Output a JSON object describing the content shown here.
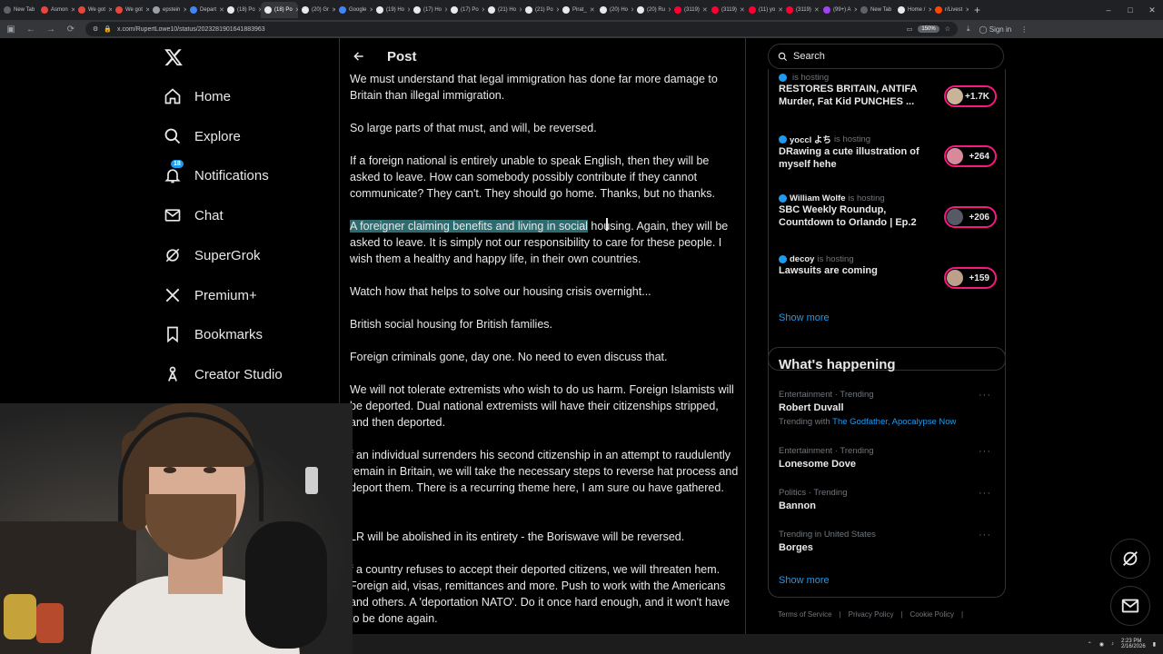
{
  "browser": {
    "tabs": [
      "New Tab",
      "Asmon",
      "We got",
      "We got",
      "epstein",
      "Depart",
      "(18) Po",
      "(18) Po",
      "(20) Gr",
      "Google",
      "(19) Ho",
      "(17) Ho",
      "(17) Po",
      "(21) Ho",
      "(21) Po",
      "Pirat_",
      "(20) Ho",
      "(20) Ru",
      "(3119)",
      "(3119)",
      "(11) yo",
      "(3119)",
      "(99+) A",
      "New Tab",
      "Home /",
      "r/Livest"
    ],
    "active_tab_index": 7,
    "url": "x.com/RupertLowe10/status/2023281901641883963",
    "zoom": "150%",
    "sign_in": "Sign in"
  },
  "nav": {
    "items": [
      {
        "label": "Home",
        "icon": "home-icon"
      },
      {
        "label": "Explore",
        "icon": "search-icon"
      },
      {
        "label": "Notifications",
        "icon": "bell-icon",
        "badge": "18"
      },
      {
        "label": "Chat",
        "icon": "mail-icon"
      },
      {
        "label": "SuperGrok",
        "icon": "grok-icon"
      },
      {
        "label": "Premium+",
        "icon": "x-icon"
      },
      {
        "label": "Bookmarks",
        "icon": "bookmark-icon"
      },
      {
        "label": "Creator Studio",
        "icon": "creator-icon"
      }
    ]
  },
  "post": {
    "header_title": "Post",
    "paragraphs": [
      "We must understand that legal immigration has done far more damage to Britain than illegal immigration.",
      "So large parts of that must, and will, be reversed.",
      "If a foreign national is entirely unable to speak English, then they will be asked to leave. How can somebody possibly contribute if they cannot communicate? They can't. They should go home. Thanks, but no thanks.",
      "Watch how that helps to solve our housing crisis overnight...",
      "British social housing for British families.",
      "Foreign criminals gone, day one. No need to even discuss that.",
      "We will not tolerate extremists who wish to do us harm. Foreign Islamists will be deported. Dual national extremists will have their citizenships stripped, and then deported.",
      "f an individual surrenders his second citizenship in an attempt to raudulently remain in Britain, we will take the necessary steps to reverse hat process and deport them. There is a recurring theme here, I am sure ou have gathered.",
      "LR will be abolished in its entirety - the Boriswave will be reversed.",
      "f a country refuses to accept their deported citizens, we will threaten hem. Foreign aid, visas, remittances and more. Push to work with the Americans and others. A 'deportation NATO'. Do it once hard enough, and it won't have to be done again."
    ],
    "highlight_para": {
      "selected": "A foreigner claiming benefits and living in social",
      "rest": " housing. Again, they will be asked to leave. It is simply not our responsibility to care for these people. I wish them a healthy and happy life, in their own countries."
    }
  },
  "right": {
    "search_placeholder": "Search",
    "live": [
      {
        "host": "",
        "host_suffix": "is hosting",
        "title": "RESTORES BRITAIN, ANTIFA Murder, Fat Kid PUNCHES ...",
        "count": "+1.7K",
        "avatar_color": "#c9b49a"
      },
      {
        "host": "yoccl よち",
        "host_suffix": "is hosting",
        "title": "DRawing a cute illustration of myself hehe",
        "count": "+264",
        "avatar_color": "#d98a9a"
      },
      {
        "host": "William Wolfe",
        "host_suffix": "is hosting",
        "title": "SBC Weekly Roundup, Countdown to Orlando | Ep.2",
        "count": "+206",
        "avatar_color": "#555a66"
      },
      {
        "host": "decoy",
        "host_suffix": "is hosting",
        "title": "Lawsuits are coming",
        "count": "+159",
        "avatar_color": "#bda08a"
      }
    ],
    "live_show_more": "Show more",
    "happening_title": "What's happening",
    "trends": [
      {
        "category": "Entertainment · Trending",
        "name": "Robert Duvall",
        "with_label": "Trending with",
        "with_links": "The Godfather, Apocalypse Now"
      },
      {
        "category": "Entertainment · Trending",
        "name": "Lonesome Dove",
        "with_label": "",
        "with_links": ""
      },
      {
        "category": "Politics · Trending",
        "name": "Bannon",
        "with_label": "",
        "with_links": ""
      },
      {
        "category": "Trending in United States",
        "name": "Borges",
        "with_label": "",
        "with_links": ""
      }
    ],
    "trends_show_more": "Show more",
    "footer": [
      "Terms of Service",
      "|",
      "Privacy Policy",
      "|",
      "Cookie Policy",
      "|"
    ]
  },
  "taskbar": {
    "time": "2:23 PM",
    "date": "2/16/2026"
  },
  "colors": {
    "accent": "#1d9bf0",
    "live_ring": "#f91880",
    "highlight": "#2c6b6f",
    "border": "#2f3336"
  }
}
